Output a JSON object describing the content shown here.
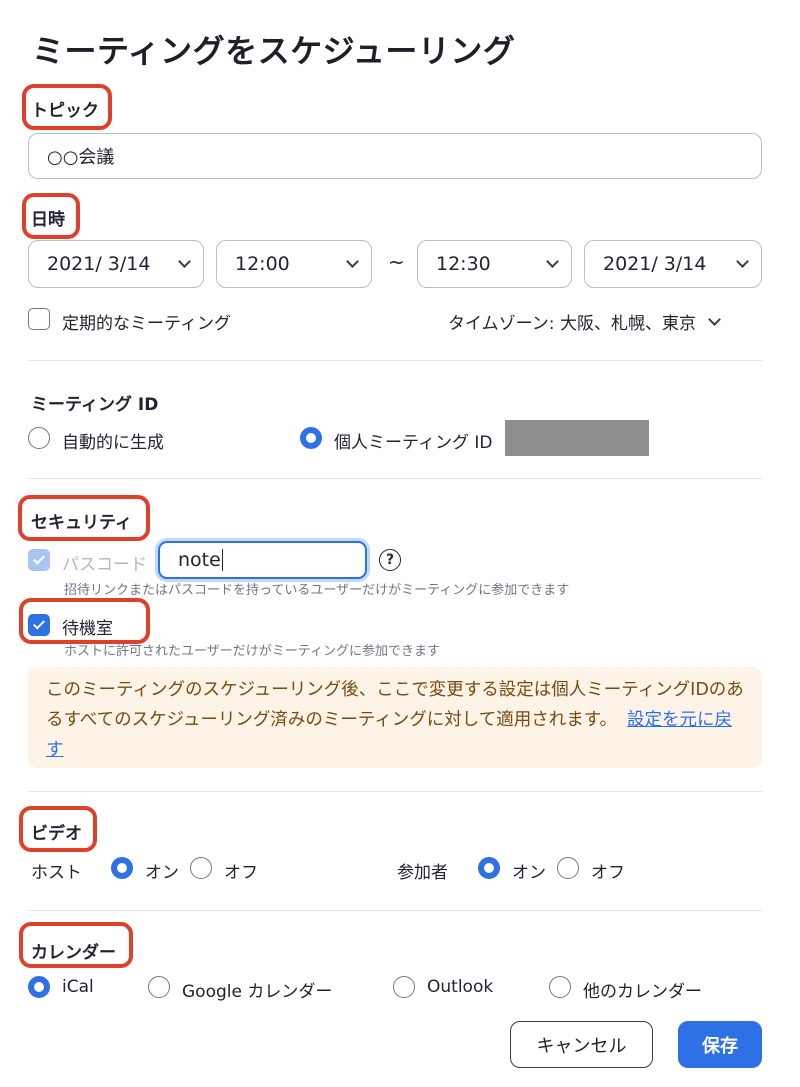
{
  "title": "ミーティングをスケジューリング",
  "topic": {
    "label": "トピック",
    "value": "○○会議"
  },
  "datetime": {
    "label": "日時",
    "start_date": "2021/  3/14",
    "start_time": "12:00",
    "separator": "~",
    "end_time": "12:30",
    "end_date": "2021/  3/14",
    "recurring_label": "定期的なミーティング",
    "recurring_checked": false,
    "timezone": "タイムゾーン:  大阪、札幌、東京"
  },
  "meeting_id": {
    "label": "ミーティング ID",
    "auto_label": "自動的に生成",
    "personal_label": "個人ミーティング ID",
    "selected": "personal"
  },
  "security": {
    "label": "セキュリティ",
    "passcode_label": "パスコード",
    "passcode_value": "note",
    "passcode_help": "?",
    "passcode_desc": "招待リンクまたはパスコードを持っているユーザーだけがミーティングに参加できます",
    "waiting_room_label": "待機室",
    "waiting_room_desc": "ホストに許可されたユーザーだけがミーティングに参加できます"
  },
  "notice": {
    "text": "このミーティングのスケジューリング後、ここで変更する設定は個人ミーティングIDのあるすべてのスケジューリング済みのミーティングに対して適用されます。",
    "link": "設定を元に戻す"
  },
  "video": {
    "label": "ビデオ",
    "host_label": "ホスト",
    "participant_label": "参加者",
    "on_label": "オン",
    "off_label": "オフ",
    "host_value": "on",
    "participant_value": "on"
  },
  "calendar": {
    "label": "カレンダー",
    "options": [
      "iCal",
      "Google カレンダー",
      "Outlook",
      "他のカレンダー"
    ],
    "selected": 0
  },
  "buttons": {
    "cancel": "キャンセル",
    "save": "保存"
  },
  "colors": {
    "accent": "#2e70e5",
    "highlight": "#e0402a",
    "notice_bg": "#fdf3e7",
    "notice_text": "#7a4a10"
  }
}
